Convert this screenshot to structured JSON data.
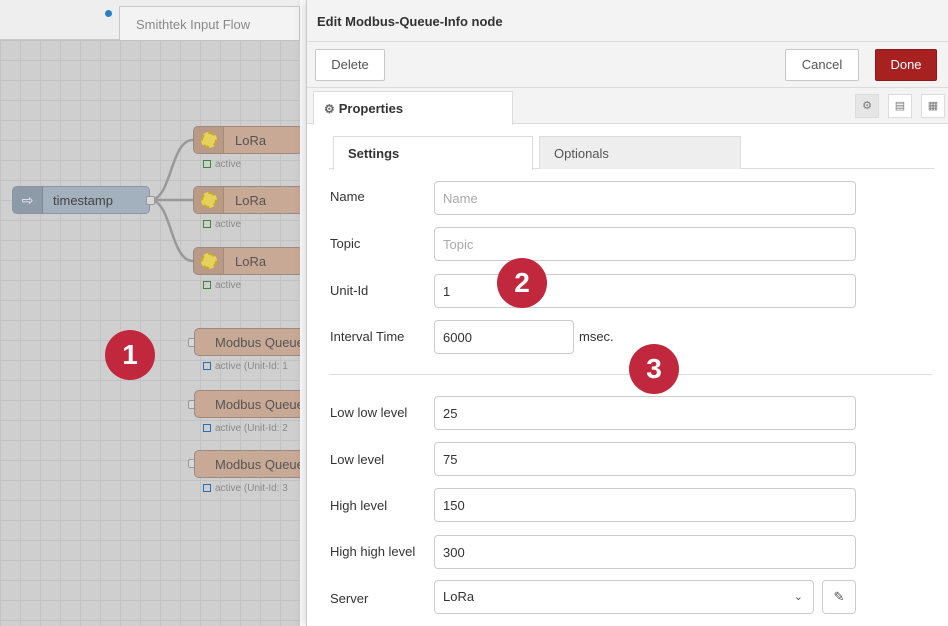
{
  "workspace": {
    "flow_tab_label": "Smithtek Input Flow",
    "timestamp_node": "timestamp",
    "lora_nodes": [
      {
        "label": "LoRa",
        "status": "active"
      },
      {
        "label": "LoRa",
        "status": "active"
      },
      {
        "label": "LoRa",
        "status": "active"
      }
    ],
    "modbus_nodes": [
      {
        "label": "Modbus Queue",
        "status": "active (Unit-Id: 1"
      },
      {
        "label": "Modbus Queue",
        "status": "active (Unit-Id: 2"
      },
      {
        "label": "Modbus Queue",
        "status": "active (Unit-Id: 3"
      }
    ]
  },
  "badges": [
    "1",
    "2",
    "3"
  ],
  "panel": {
    "title": "Edit Modbus-Queue-Info node",
    "delete_label": "Delete",
    "cancel_label": "Cancel",
    "done_label": "Done",
    "properties_tab": "Properties",
    "subtabs": {
      "settings": "Settings",
      "optionals": "Optionals"
    },
    "fields": {
      "name": {
        "label": "Name",
        "placeholder": "Name",
        "value": ""
      },
      "topic": {
        "label": "Topic",
        "placeholder": "Topic",
        "value": ""
      },
      "unit_id": {
        "label": "Unit-Id",
        "value": "1"
      },
      "interval": {
        "label": "Interval Time",
        "value": "6000",
        "unit": "msec."
      },
      "low_low": {
        "label": "Low low level",
        "value": "25"
      },
      "low": {
        "label": "Low level",
        "value": "75"
      },
      "high": {
        "label": "High level",
        "value": "150"
      },
      "high_high": {
        "label": "High high level",
        "value": "300"
      },
      "server": {
        "label": "Server",
        "value": "LoRa"
      }
    }
  },
  "colors": {
    "done_button": "#a82121",
    "badge": "#c1273d",
    "lora_node": "#c8a995",
    "timestamp_node": "#a3b0bd"
  },
  "icons": {
    "properties": "gear-icon",
    "server_edit": "pencil-icon",
    "server_dropdown": "chevron-down-icon",
    "timestamp": "arrow-right-icon"
  }
}
